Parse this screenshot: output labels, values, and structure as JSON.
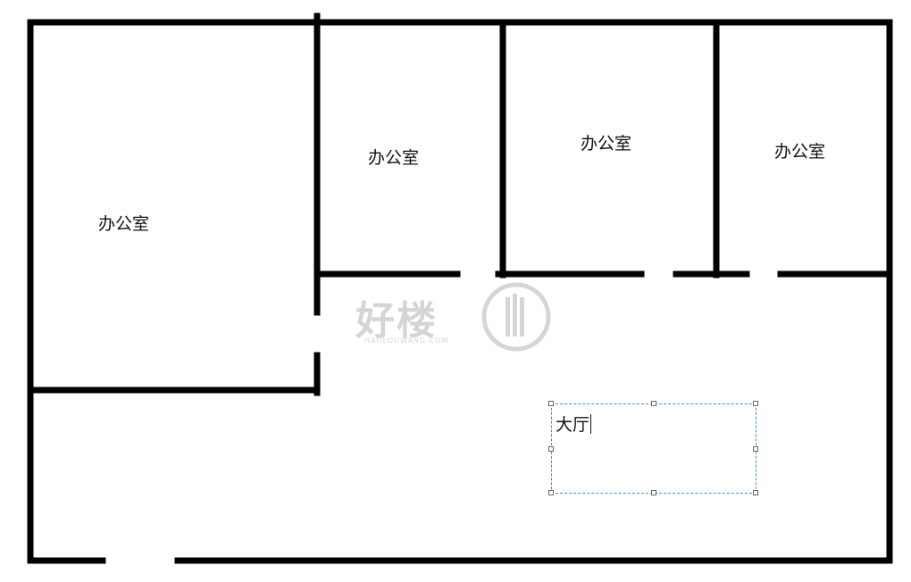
{
  "floor_plan": {
    "wall_color": "#000000",
    "rooms": [
      {
        "label": "办公室"
      },
      {
        "label": "办公室"
      },
      {
        "label": "办公室"
      },
      {
        "label": "办公室"
      }
    ],
    "hall": {
      "label": "大厅"
    }
  },
  "watermark": {
    "text": "好楼",
    "subtext": "HAOLOUWANG.COM"
  },
  "selection_box": {
    "border_color": "#3a8ee0"
  }
}
